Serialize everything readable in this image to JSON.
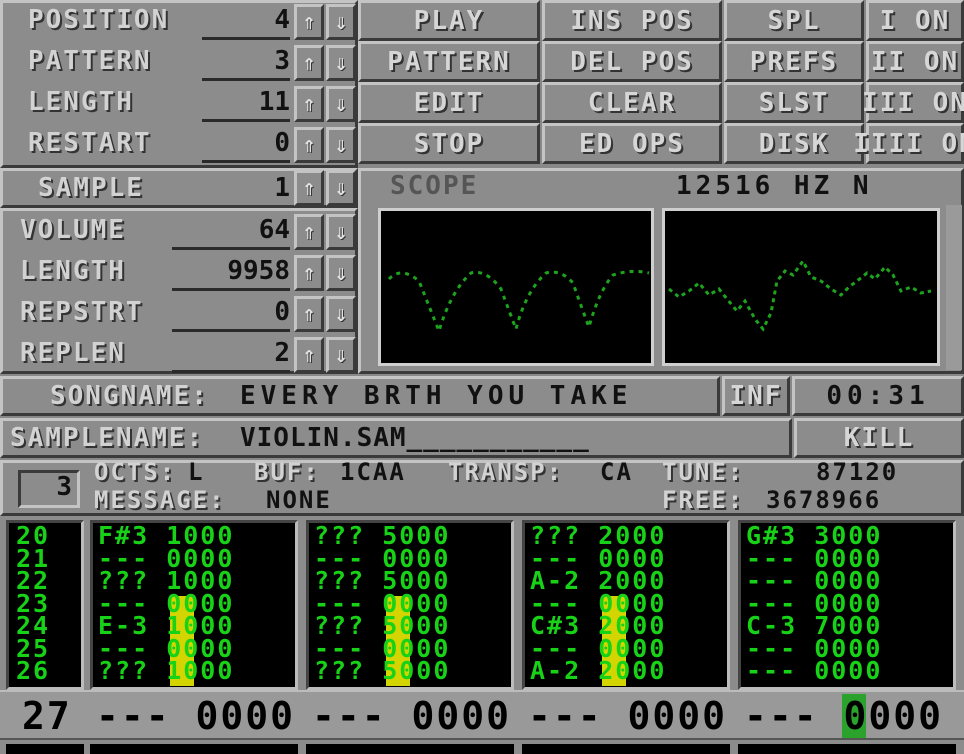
{
  "song": {
    "rows": [
      {
        "label": "POSITION",
        "value": "4"
      },
      {
        "label": "PATTERN",
        "value": "3"
      },
      {
        "label": "LENGTH",
        "value": "11"
      },
      {
        "label": "RESTART",
        "value": "0"
      }
    ],
    "up_glyph": "⇑",
    "down_glyph": "⇓"
  },
  "main_buttons": [
    "PLAY",
    "PATTERN",
    "EDIT",
    "STOP"
  ],
  "edit_buttons": [
    "INS POS",
    "DEL POS",
    "CLEAR",
    "ED OPS"
  ],
  "menu_buttons": [
    "SPL",
    "PREFS",
    "SLST",
    "DISK"
  ],
  "channel_toggles": [
    "I ON",
    "II ON",
    "III ON",
    "IIII ON"
  ],
  "sample": {
    "label": "SAMPLE",
    "value": "1"
  },
  "sample_params": [
    {
      "label": "VOLUME",
      "value": "64"
    },
    {
      "label": "LENGTH",
      "value": "9958"
    },
    {
      "label": "REPSTRT",
      "value": "0"
    },
    {
      "label": "REPLEN",
      "value": "2"
    }
  ],
  "scope": {
    "label": "SCOPE",
    "freq": "12516 HZ N"
  },
  "songname": {
    "label": "SONGNAME:",
    "value": "EVERY BRTH YOU TAKE"
  },
  "inf_button": "INF",
  "timer": "00:31",
  "samplename": {
    "label": "SAMPLENAME:",
    "value": "VIOLIN.SAM___________"
  },
  "kill_button": "KILL",
  "info": {
    "box_number": "3",
    "octs_label": "OCTS:",
    "octs_value": "L",
    "buf_label": "BUF:",
    "buf_value": "1CAA",
    "transp_label": "TRANSP:",
    "transp_value": "CA",
    "tune_label": "TUNE:",
    "tune_value": "87120",
    "message_label": "MESSAGE:",
    "message_value": "NONE",
    "free_label": "FREE:",
    "free_value": "3678966"
  },
  "pattern": {
    "row_numbers": [
      "20",
      "21",
      "22",
      "23",
      "24",
      "25",
      "26"
    ],
    "tracks": [
      {
        "notes": [
          "F#3 1000",
          "--- 0000",
          "??? 1000",
          "--- 0000",
          "E-3 1000",
          "--- 0000",
          "??? 1000"
        ]
      },
      {
        "notes": [
          "??? 5000",
          "--- 0000",
          "??? 5000",
          "--- 0000",
          "??? 5000",
          "--- 0000",
          "??? 5000"
        ]
      },
      {
        "notes": [
          "??? 2000",
          "--- 0000",
          "A-2 2000",
          "--- 0000",
          "C#3 2000",
          "--- 0000",
          "A-2 2000"
        ]
      },
      {
        "notes": [
          "G#3 3000",
          "--- 0000",
          "--- 0000",
          "--- 0000",
          "C-3 7000",
          "--- 0000",
          "--- 0000"
        ]
      }
    ],
    "current_row": {
      "number": "27",
      "cells": [
        "--- 0000",
        "--- 0000",
        "--- 0000",
        "--- 0000"
      ]
    }
  },
  "colors": {
    "panel": "#8c8c8c",
    "pattern_text": "#17d217",
    "vu_meter": "#d4d400",
    "cursor": "#1fa31f"
  }
}
